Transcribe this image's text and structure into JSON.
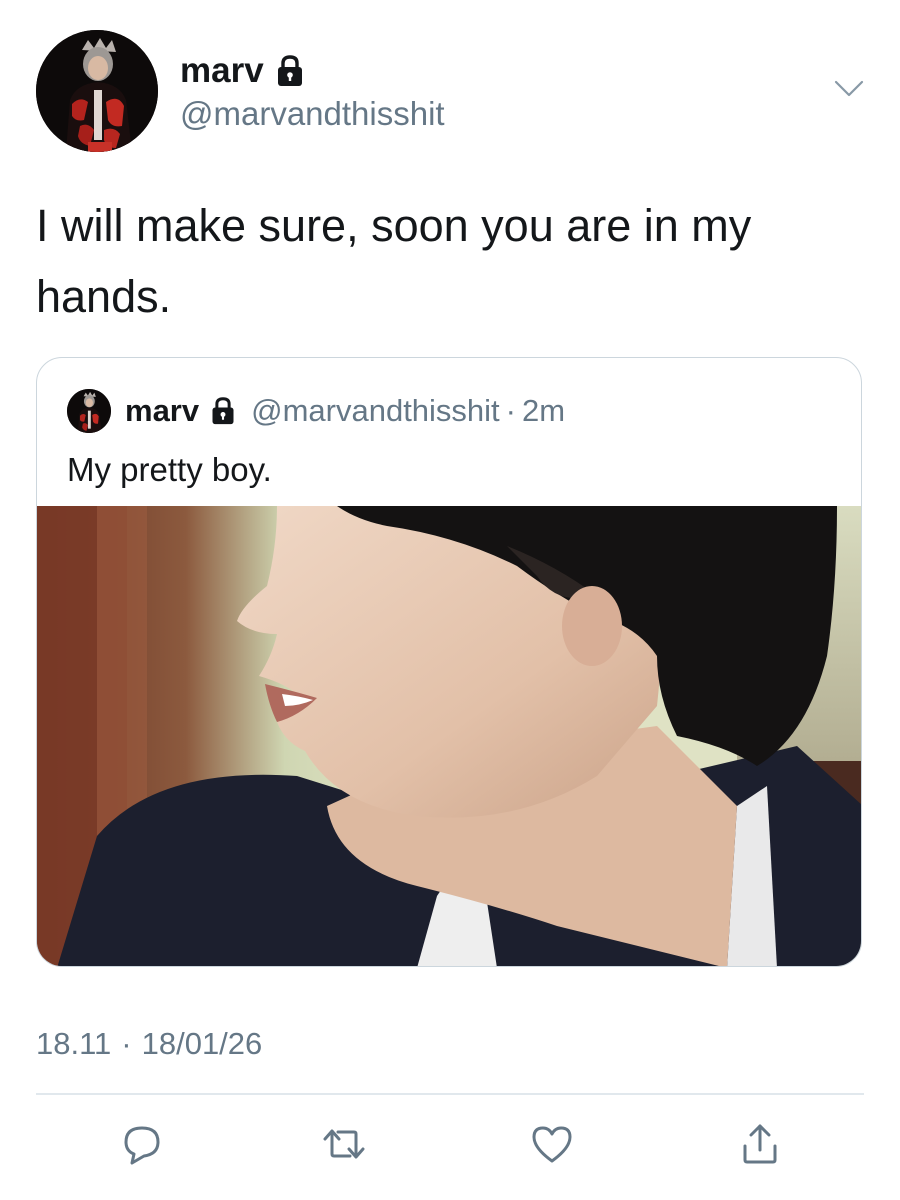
{
  "tweet": {
    "author": {
      "display_name": "marv",
      "handle": "@marvandthisshit",
      "protected": true
    },
    "text": "I will make sure, soon you are in my hands.",
    "quoted_tweet": {
      "author": {
        "display_name": "marv",
        "handle": "@marvandthisshit",
        "protected": true
      },
      "separator": "·",
      "relative_time": "2m",
      "text": "My pretty boy."
    },
    "timestamp": {
      "time": "18.11",
      "separator": "·",
      "date": "18/01/26"
    }
  },
  "actions": [
    "reply-icon",
    "retweet-icon",
    "like-icon",
    "share-icon"
  ],
  "colors": {
    "text_primary": "#14171a",
    "text_secondary": "#657786",
    "border": "#ccd6dd",
    "divider": "#e1e8ed"
  }
}
